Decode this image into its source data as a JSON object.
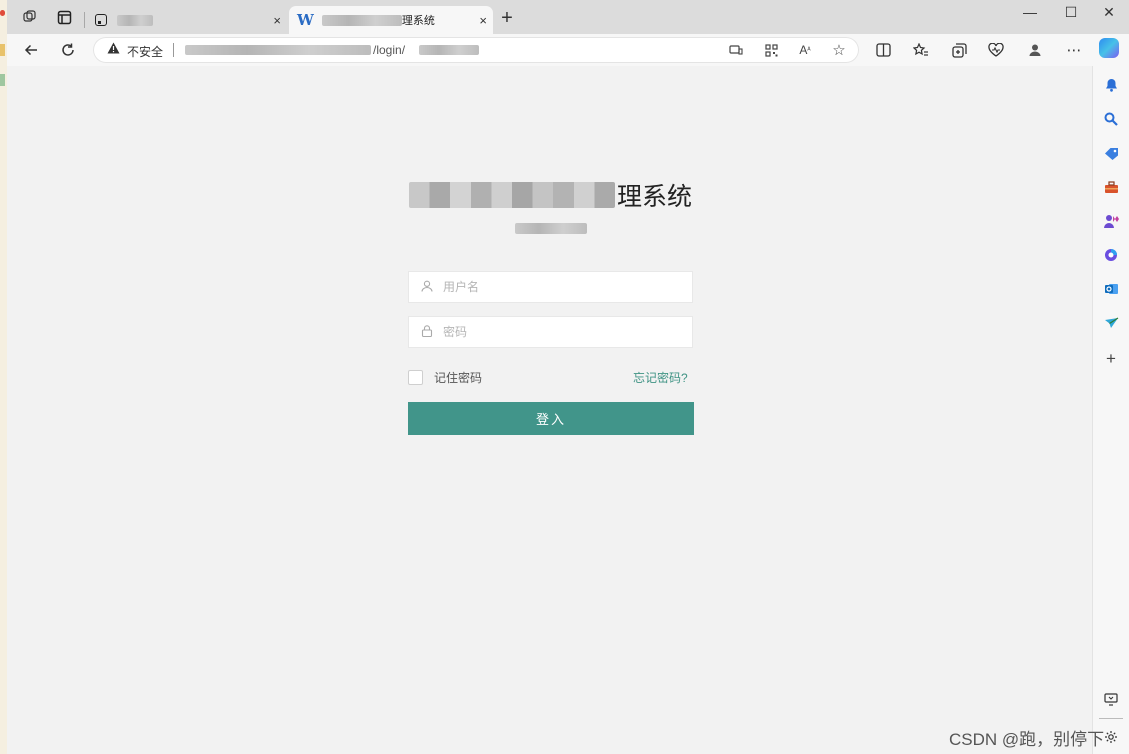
{
  "tabs": [
    {
      "title": "",
      "close": "×"
    },
    {
      "title_suffix": "理系统",
      "close": "×"
    }
  ],
  "new_tab": "+",
  "window_controls": {
    "minimize": "—",
    "maximize": "☐",
    "close": "✕"
  },
  "address": {
    "security_label": "不安全",
    "url_visible": "/login/"
  },
  "login": {
    "title_suffix": "理系统",
    "username_placeholder": "用户名",
    "password_placeholder": "密码",
    "remember_label": "记住密码",
    "forgot_label": "忘记密码?",
    "submit_label": "登入"
  },
  "sidebar_icons": [
    "bell-icon",
    "search-icon",
    "tag-icon",
    "toolbox-icon",
    "people-icon",
    "office-icon",
    "outlook-icon",
    "send-icon",
    "plus-icon"
  ],
  "watermark": "CSDN @跑，别停下",
  "colors": {
    "primary": "#41958a",
    "link": "#3f9384"
  }
}
